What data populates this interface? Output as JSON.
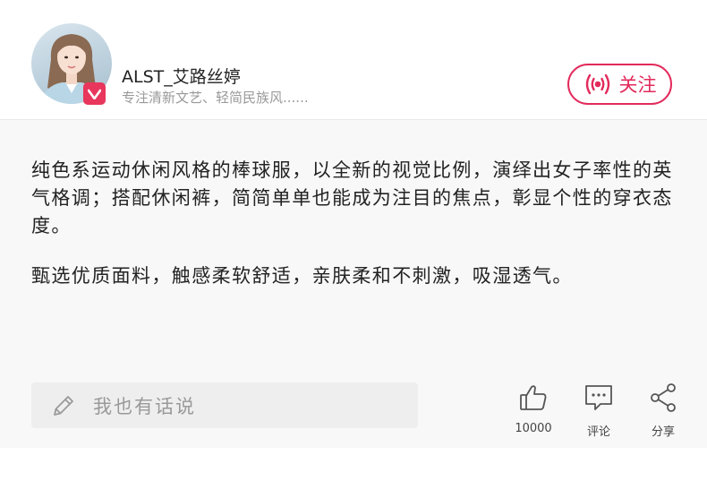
{
  "author": {
    "name": "ALST_艾路丝婷",
    "description": "专注清新文艺、轻简民族风......"
  },
  "follow_button": {
    "label": "关注"
  },
  "post": {
    "paragraphs": [
      "纯色系运动休闲风格的棒球服，以全新的视觉比例，演绎出女子率性的英气格调；搭配休闲裤，简简单单也能成为注目的焦点，彰显个性的穿衣态度。",
      "甄选优质面料，触感柔软舒适，亲肤柔和不刺激，吸湿透气。"
    ]
  },
  "comment_input": {
    "placeholder": "我也有话说"
  },
  "actions": {
    "like": {
      "count": "10000",
      "icon": "thumbs-up-icon"
    },
    "comment": {
      "label": "评论",
      "icon": "comment-icon"
    },
    "share": {
      "label": "分享",
      "icon": "share-icon"
    }
  },
  "colors": {
    "accent": "#e22a5b",
    "badge": "#e8365d",
    "body_bg": "#f8f8f8"
  }
}
